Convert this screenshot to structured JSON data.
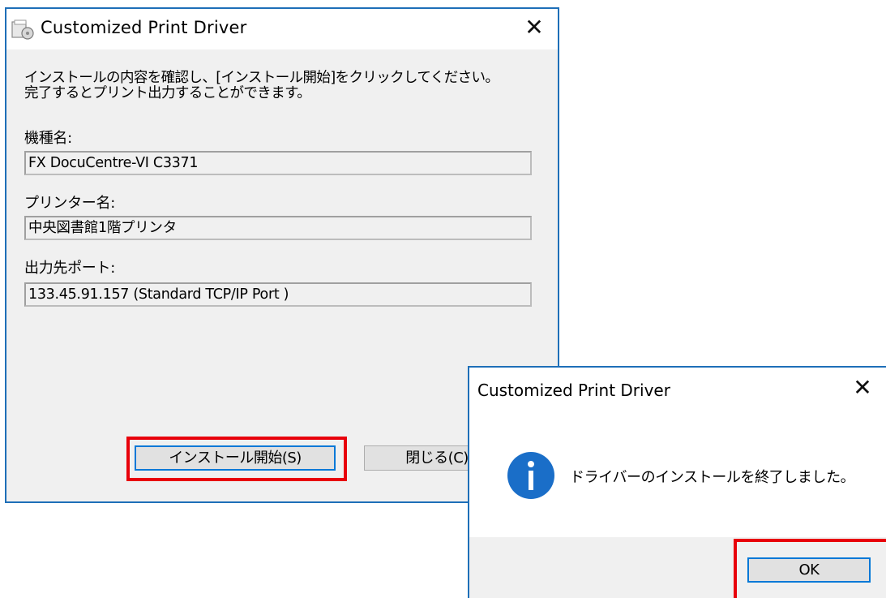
{
  "main_dialog": {
    "title": "Customized Print Driver",
    "close_glyph": "✕",
    "instructions": "インストールの内容を確認し、[インストール開始]をクリックしてください。\n完了するとプリント出力することができます。",
    "fields": [
      {
        "label": "機種名:",
        "value": "FX DocuCentre-VI C3371"
      },
      {
        "label": "プリンター名:",
        "value": "中央図書館1階プリンタ"
      },
      {
        "label": "出力先ポート:",
        "value": "133.45.91.157 (Standard TCP/IP Port )"
      }
    ],
    "buttons": {
      "install": "インストール開始(S)",
      "close": "閉じる(C)"
    }
  },
  "message_box": {
    "title": "Customized Print Driver",
    "close_glyph": "✕",
    "icon": "info-icon",
    "message": "ドライバーのインストールを終了しました。",
    "ok": "OK"
  },
  "colors": {
    "window_border": "#1e6fb8",
    "highlight": "#e8000b",
    "focus": "#0078d7",
    "dialog_bg": "#f0f0f0",
    "info_icon": "#1a6ec8"
  }
}
